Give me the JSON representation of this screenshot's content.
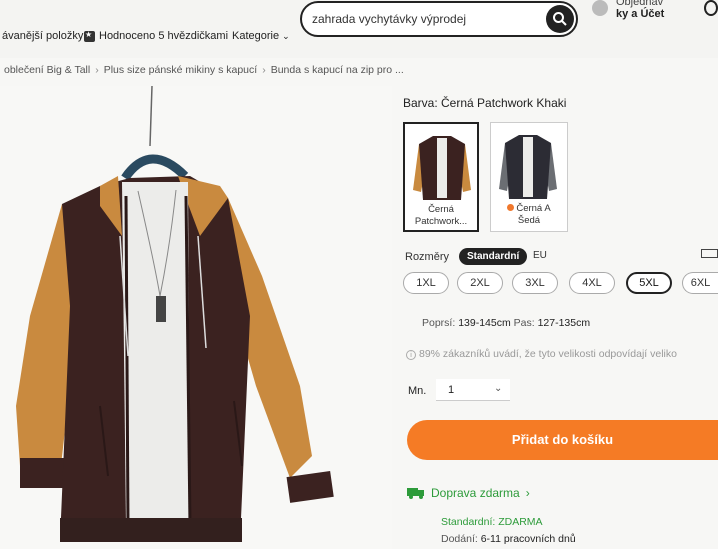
{
  "header": {
    "nav": {
      "item1": "ávanější položky",
      "item2": "Hodnoceno 5 hvězdičkami",
      "item3": "Kategorie"
    },
    "search": {
      "value": "zahrada vychytávky výprodej"
    },
    "account": {
      "line1": "Objednáv",
      "line2": "ky a Účet"
    }
  },
  "breadcrumb": [
    "oblečení Big & Tall",
    "Plus size pánské mikiny s kapucí",
    "Bunda s kapucí na zip pro ..."
  ],
  "product": {
    "color_label": "Barva: Černá Patchwork Khaki",
    "swatches": [
      {
        "label_line1": "Černá",
        "label_line2": "Patchwork...",
        "selected": true
      },
      {
        "label_line1": "Černá A",
        "label_line2": "Šedá",
        "selected": false
      }
    ],
    "size_label": "Rozměry",
    "size_tabs": {
      "active": "Standardní",
      "other": "EU"
    },
    "sizes": [
      "1XL",
      "2XL",
      "3XL",
      "4XL",
      "5XL",
      "6XL"
    ],
    "selected_size": "5XL",
    "measure_chest_label": "Poprsí:",
    "measure_chest_value": "139-145cm",
    "measure_waist_label": "Pas:",
    "measure_waist_value": "127-135cm",
    "fit_note": "89% zákazníků uvádí, že tyto velikosti odpovídají veliko",
    "qty_label": "Mn.",
    "qty_value": "1",
    "add_to_cart": "Přidat do košíku",
    "shipping": {
      "title": "Doprava zdarma",
      "line1": "Standardní: ZDARMA",
      "line2_label": "Dodání:",
      "line2_value": "6-11 pracovních dnů"
    }
  },
  "colors": {
    "accent": "#f57b25",
    "shipping_green": "#2d9b3a",
    "jacket_brown": "#3b2220",
    "jacket_sleeve": "#c98a3f"
  }
}
